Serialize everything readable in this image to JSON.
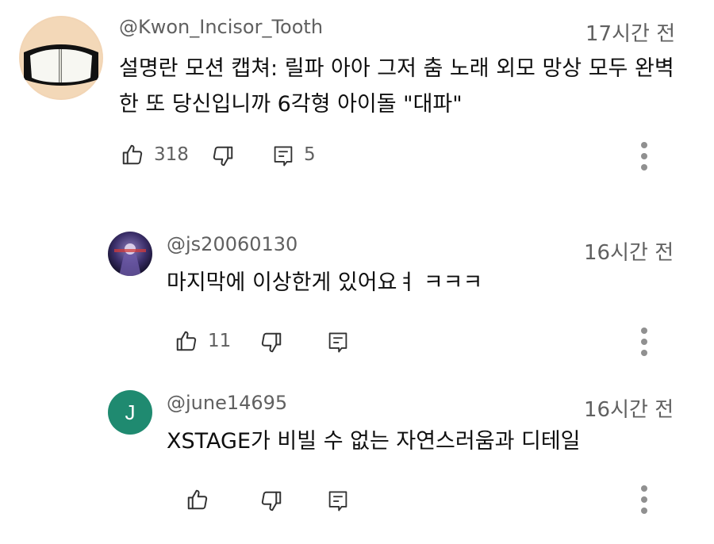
{
  "comments": [
    {
      "handle": "@Kwon_Incisor_Tooth",
      "time": "17시간 전",
      "text": "설명란 모션 캡쳐: 릴파 아아 그저 춤 노래 외모 망상 모두 완벽한 또 당신입니까 6각형 아이돌 \"대파\"",
      "likes": "318",
      "replies": "5",
      "avatar_icon": "teeth-avatar"
    },
    {
      "handle": "@js20060130",
      "time": "16시간 전",
      "text": "마지막에 이상한게 있어요ㅕ ㅋㅋㅋ",
      "likes": "11",
      "avatar_icon": "game-character-avatar"
    },
    {
      "handle": "@june14695",
      "time": "16시간 전",
      "text": "XSTAGE가 비빌 수 없는 자연스러움과 디테일",
      "avatar_initial": "J",
      "avatar_color": "#1f8a70"
    }
  ],
  "icons": {
    "like": "thumbs-up-icon",
    "dislike": "thumbs-down-icon",
    "reply": "reply-icon",
    "more": "more-vert-icon"
  }
}
